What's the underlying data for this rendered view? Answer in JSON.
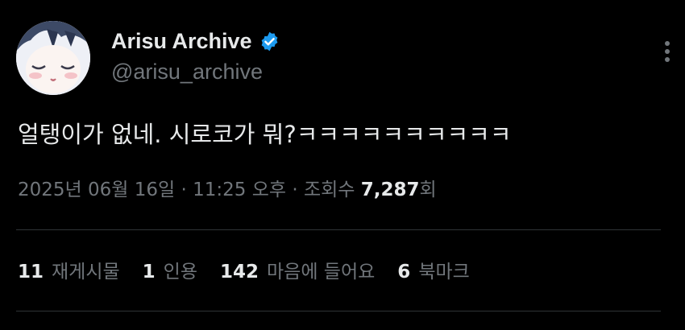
{
  "author": {
    "display_name": "Arisu Archive",
    "handle": "@arisu_archive",
    "verified_icon": "verified-badge-icon",
    "avatar": "avatar-anime-character"
  },
  "tweet": {
    "text": "얼탱이가 없네. 시로코가  뭐?ㅋㅋㅋㅋㅋㅋㅋㅋㅋㅋ"
  },
  "meta": {
    "date": "2025년 06월 16일",
    "separator1": " · ",
    "time": "11:25 오후",
    "separator2": " · ",
    "views_label": "조회수 ",
    "views_count": "7,287",
    "views_suffix": "회"
  },
  "stats": [
    {
      "count": "11",
      "label": "재게시물"
    },
    {
      "count": "1",
      "label": "인용"
    },
    {
      "count": "142",
      "label": "마음에 들어요"
    },
    {
      "count": "6",
      "label": "북마크"
    }
  ],
  "colors": {
    "background": "#000000",
    "primary_text": "#e7e9ea",
    "secondary_text": "#71767b",
    "divider": "#2f3336",
    "verified": "#1d9bf0"
  },
  "icons": {
    "more": "more-vertical-icon"
  }
}
